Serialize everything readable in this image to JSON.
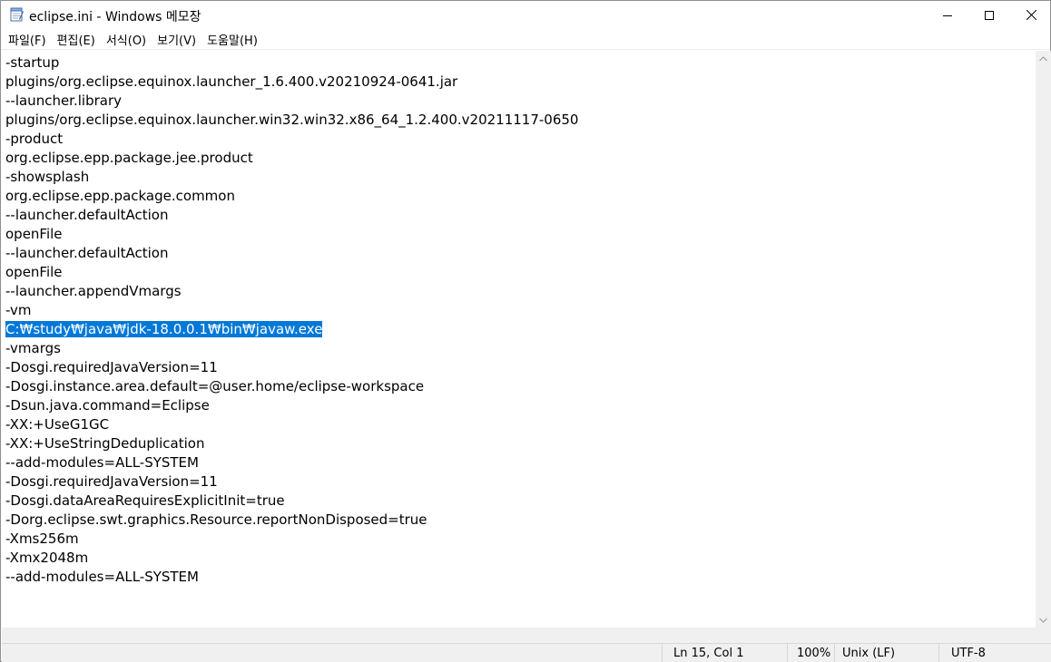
{
  "window": {
    "title": "eclipse.ini - Windows 메모장",
    "icon": "notepad-icon"
  },
  "menu": [
    {
      "label": "파일(F)"
    },
    {
      "label": "편집(E)"
    },
    {
      "label": "서식(O)"
    },
    {
      "label": "보기(V)"
    },
    {
      "label": "도움말(H)"
    }
  ],
  "editor": {
    "lines": [
      "-startup",
      "plugins/org.eclipse.equinox.launcher_1.6.400.v20210924-0641.jar",
      "--launcher.library",
      "plugins/org.eclipse.equinox.launcher.win32.win32.x86_64_1.2.400.v20211117-0650",
      "-product",
      "org.eclipse.epp.package.jee.product",
      "-showsplash",
      "org.eclipse.epp.package.common",
      "--launcher.defaultAction",
      "openFile",
      "--launcher.defaultAction",
      "openFile",
      "--launcher.appendVmargs",
      "-vm",
      "C:₩study₩java₩jdk-18.0.0.1₩bin₩javaw.exe",
      "-vmargs",
      "-Dosgi.requiredJavaVersion=11",
      "-Dosgi.instance.area.default=@user.home/eclipse-workspace",
      "-Dsun.java.command=Eclipse",
      "-XX:+UseG1GC",
      "-XX:+UseStringDeduplication",
      "--add-modules=ALL-SYSTEM",
      "-Dosgi.requiredJavaVersion=11",
      "-Dosgi.dataAreaRequiresExplicitInit=true",
      "-Dorg.eclipse.swt.graphics.Resource.reportNonDisposed=true",
      "-Xms256m",
      "-Xmx2048m",
      "--add-modules=ALL-SYSTEM"
    ],
    "selected_line_number": 15,
    "selection_color": "#0078d7"
  },
  "status": {
    "position": "Ln 15, Col 1",
    "zoom": "100%",
    "line_ending": "Unix (LF)",
    "encoding": "UTF-8"
  }
}
